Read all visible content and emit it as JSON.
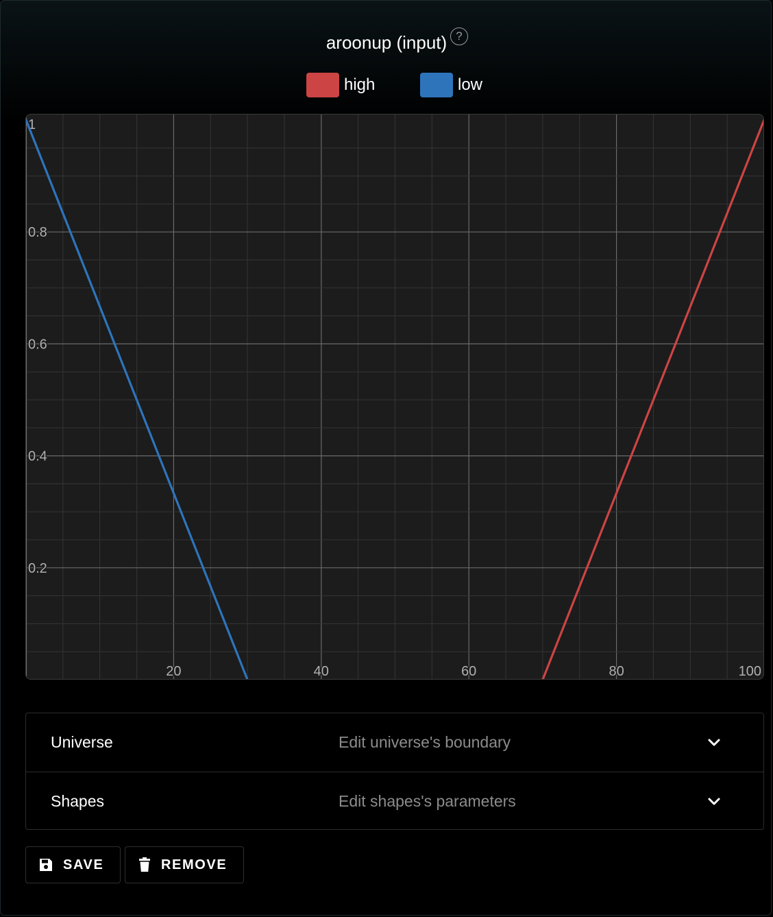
{
  "header": {
    "title": "aroonup (input)",
    "help_glyph": "?"
  },
  "legend": [
    {
      "label": "high",
      "color": "#cc4444"
    },
    {
      "label": "low",
      "color": "#2e74bb"
    }
  ],
  "chart_data": {
    "type": "line",
    "xlim": [
      0,
      100
    ],
    "ylim": [
      0,
      1
    ],
    "x_ticks": [
      "20",
      "40",
      "60",
      "80",
      "100"
    ],
    "y_ticks": [
      "0.2",
      "0.4",
      "0.6",
      "0.8",
      "1"
    ],
    "grid": true,
    "series": [
      {
        "name": "high",
        "color": "#cc4444",
        "x": [
          70,
          100
        ],
        "y": [
          0,
          1
        ]
      },
      {
        "name": "low",
        "color": "#2e74bb",
        "x": [
          0,
          30
        ],
        "y": [
          1,
          0
        ]
      }
    ]
  },
  "accordion": [
    {
      "title": "Universe",
      "subtitle": "Edit universe's boundary",
      "icon": "chevron-down-icon"
    },
    {
      "title": "Shapes",
      "subtitle": "Edit shapes's parameters",
      "icon": "chevron-down-icon"
    }
  ],
  "actions": {
    "save_label": "SAVE",
    "save_icon": "floppy-disk-icon",
    "remove_label": "REMOVE",
    "remove_icon": "trash-icon"
  }
}
